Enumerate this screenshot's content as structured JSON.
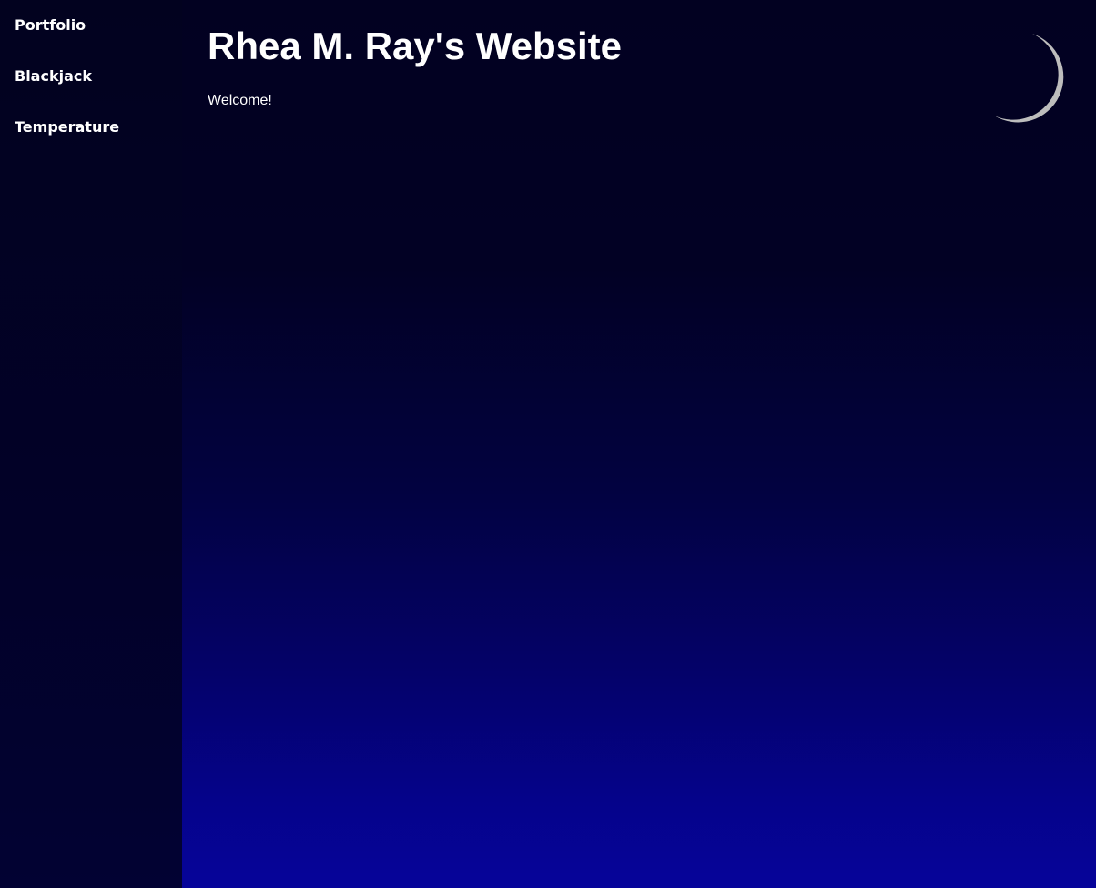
{
  "sidebar": {
    "items": [
      {
        "label": "Portfolio"
      },
      {
        "label": "Blackjack"
      },
      {
        "label": "Temperature"
      }
    ]
  },
  "header": {
    "title": "Rhea M. Ray's Website"
  },
  "main": {
    "welcome": "Welcome!"
  },
  "icons": {
    "moon": "moon-icon"
  },
  "colors": {
    "text": "#ffffff",
    "moon": "#bdbdbd",
    "background_top": "#020124",
    "background_bottom": "#06049a"
  }
}
